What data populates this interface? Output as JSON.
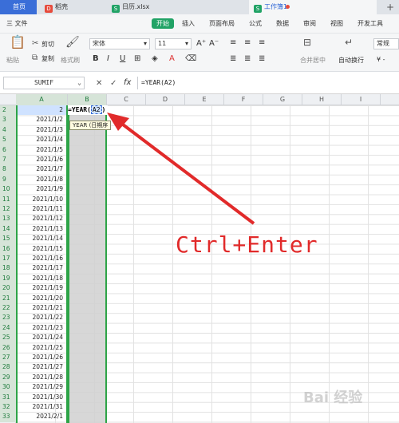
{
  "tabs": [
    {
      "label": "首页"
    },
    {
      "label": "稻壳"
    },
    {
      "label": "日历.xlsx"
    },
    {
      "label": "工作簿1"
    }
  ],
  "menu": [
    "三 文件",
    "开始",
    "插入",
    "页面布局",
    "公式",
    "数据",
    "审阅",
    "视图",
    "开发工具"
  ],
  "toolbar": {
    "cut": "剪切",
    "paste": "粘贴",
    "copy": "复制",
    "format_painter": "格式刷",
    "font_name": "宋体",
    "font_size": "11",
    "merge_center": "合并居中",
    "wrap_text": "自动换行",
    "number_format": "常规"
  },
  "formula_bar": {
    "name_box": "SUMIF",
    "fx": "fx",
    "formula": "=YEAR(A2)"
  },
  "columns": [
    "A",
    "B",
    "C",
    "D",
    "E",
    "F",
    "G",
    "H",
    "I"
  ],
  "rows": [
    "2",
    "3",
    "4",
    "5",
    "6",
    "7",
    "8",
    "9",
    "10",
    "11",
    "12",
    "13",
    "14",
    "15",
    "16",
    "17",
    "18",
    "19",
    "20",
    "21",
    "22",
    "23",
    "24",
    "25",
    "26",
    "27",
    "28",
    "29",
    "30",
    "31",
    "32",
    "33"
  ],
  "cells_A": [
    "2",
    "2021/1/2",
    "2021/1/3",
    "2021/1/4",
    "2021/1/5",
    "2021/1/6",
    "2021/1/7",
    "2021/1/8",
    "2021/1/9",
    "2021/1/10",
    "2021/1/11",
    "2021/1/12",
    "2021/1/13",
    "2021/1/14",
    "2021/1/15",
    "2021/1/16",
    "2021/1/17",
    "2021/1/18",
    "2021/1/19",
    "2021/1/20",
    "2021/1/21",
    "2021/1/22",
    "2021/1/23",
    "2021/1/24",
    "2021/1/25",
    "2021/1/26",
    "2021/1/27",
    "2021/1/28",
    "2021/1/29",
    "2021/1/30",
    "2021/1/31",
    "2021/2/1"
  ],
  "edit_cell": {
    "prefix": "=YEAR(",
    "ref": "A2",
    "suffix": ")"
  },
  "tooltip": "YEAR (日期序",
  "annotation": "Ctrl+Enter",
  "watermark": "Bai 经验",
  "colors": {
    "accent_green": "#21a366",
    "select_border": "#2da447",
    "arrow_red": "#e12a2a"
  }
}
